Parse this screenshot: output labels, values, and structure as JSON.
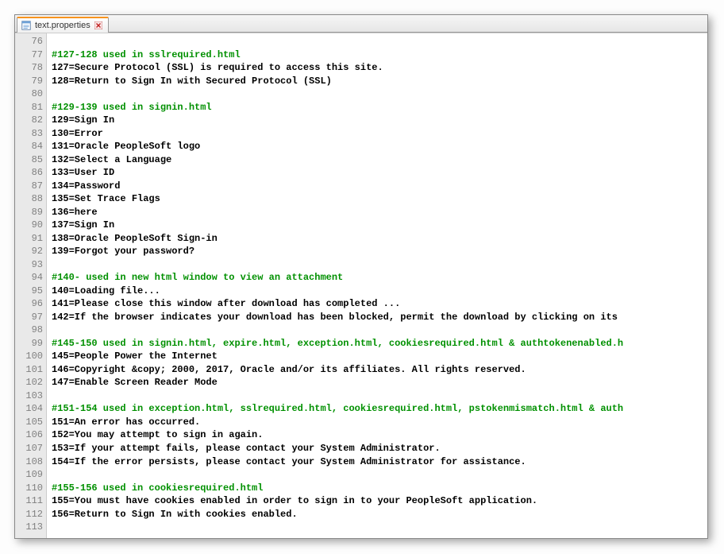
{
  "tab": {
    "label": "text.properties"
  },
  "firstLineNumber": 76,
  "lines": [
    {
      "segments": []
    },
    {
      "segments": [
        {
          "t": "comment",
          "v": "#127-128 used in sslrequired.html"
        }
      ]
    },
    {
      "segments": [
        {
          "t": "text",
          "v": "127=Secure Protocol (SSL) is required to access this site."
        }
      ]
    },
    {
      "segments": [
        {
          "t": "text",
          "v": "128=Return to Sign In with Secured Protocol (SSL)"
        }
      ]
    },
    {
      "segments": []
    },
    {
      "segments": [
        {
          "t": "comment",
          "v": "#129-139 used in signin.html"
        }
      ]
    },
    {
      "segments": [
        {
          "t": "text",
          "v": "129=Sign In"
        }
      ]
    },
    {
      "segments": [
        {
          "t": "text",
          "v": "130=Error"
        }
      ]
    },
    {
      "segments": [
        {
          "t": "text",
          "v": "131=Oracle PeopleSoft logo"
        }
      ]
    },
    {
      "segments": [
        {
          "t": "text",
          "v": "132=Select a Language"
        }
      ]
    },
    {
      "segments": [
        {
          "t": "text",
          "v": "133=User ID"
        }
      ]
    },
    {
      "segments": [
        {
          "t": "text",
          "v": "134=Password"
        }
      ]
    },
    {
      "segments": [
        {
          "t": "text",
          "v": "135=Set Trace Flags"
        }
      ]
    },
    {
      "segments": [
        {
          "t": "text",
          "v": "136=here"
        }
      ]
    },
    {
      "segments": [
        {
          "t": "text",
          "v": "137=Sign In"
        }
      ]
    },
    {
      "segments": [
        {
          "t": "text",
          "v": "138=Oracle PeopleSoft Sign-in"
        }
      ]
    },
    {
      "segments": [
        {
          "t": "text",
          "v": "139=Forgot your password?"
        }
      ]
    },
    {
      "segments": []
    },
    {
      "segments": [
        {
          "t": "comment",
          "v": "#140- used in new html window to view an attachment"
        }
      ]
    },
    {
      "segments": [
        {
          "t": "text",
          "v": "140=Loading file..."
        }
      ]
    },
    {
      "segments": [
        {
          "t": "text",
          "v": "141=Please close this window after download has completed ..."
        }
      ]
    },
    {
      "segments": [
        {
          "t": "text",
          "v": "142=If the browser indicates your download has been blocked, permit the download by clicking on its"
        }
      ]
    },
    {
      "segments": []
    },
    {
      "segments": [
        {
          "t": "comment",
          "v": "#145-150 used in signin.html, expire.html, exception.html, cookiesrequired.html & authtokenenabled.h"
        }
      ]
    },
    {
      "segments": [
        {
          "t": "text",
          "v": "145=People Power the Internet"
        }
      ]
    },
    {
      "segments": [
        {
          "t": "text",
          "v": "146=Copyright &copy; 2000, 2017, Oracle and/or its affiliates. All rights reserved."
        }
      ]
    },
    {
      "segments": [
        {
          "t": "text",
          "v": "147=Enable Screen Reader Mode"
        }
      ]
    },
    {
      "segments": []
    },
    {
      "segments": [
        {
          "t": "comment",
          "v": "#151-154 used in exception.html, sslrequired.html, cookiesrequired.html, pstokenmismatch.html & auth"
        }
      ]
    },
    {
      "segments": [
        {
          "t": "text",
          "v": "151=An error has occurred."
        }
      ]
    },
    {
      "segments": [
        {
          "t": "text",
          "v": "152=You may attempt to sign in again."
        }
      ]
    },
    {
      "segments": [
        {
          "t": "text",
          "v": "153=If your attempt fails, please contact your System Administrator."
        }
      ]
    },
    {
      "segments": [
        {
          "t": "text",
          "v": "154=If the error persists, please contact your System Administrator for assistance."
        }
      ]
    },
    {
      "segments": []
    },
    {
      "segments": [
        {
          "t": "comment",
          "v": "#155-156 used in cookiesrequired.html"
        }
      ]
    },
    {
      "segments": [
        {
          "t": "text",
          "v": "155=You must have cookies enabled in order to sign in to your PeopleSoft application."
        }
      ]
    },
    {
      "segments": [
        {
          "t": "text",
          "v": "156=Return to Sign In with cookies enabled."
        }
      ]
    },
    {
      "segments": []
    }
  ]
}
